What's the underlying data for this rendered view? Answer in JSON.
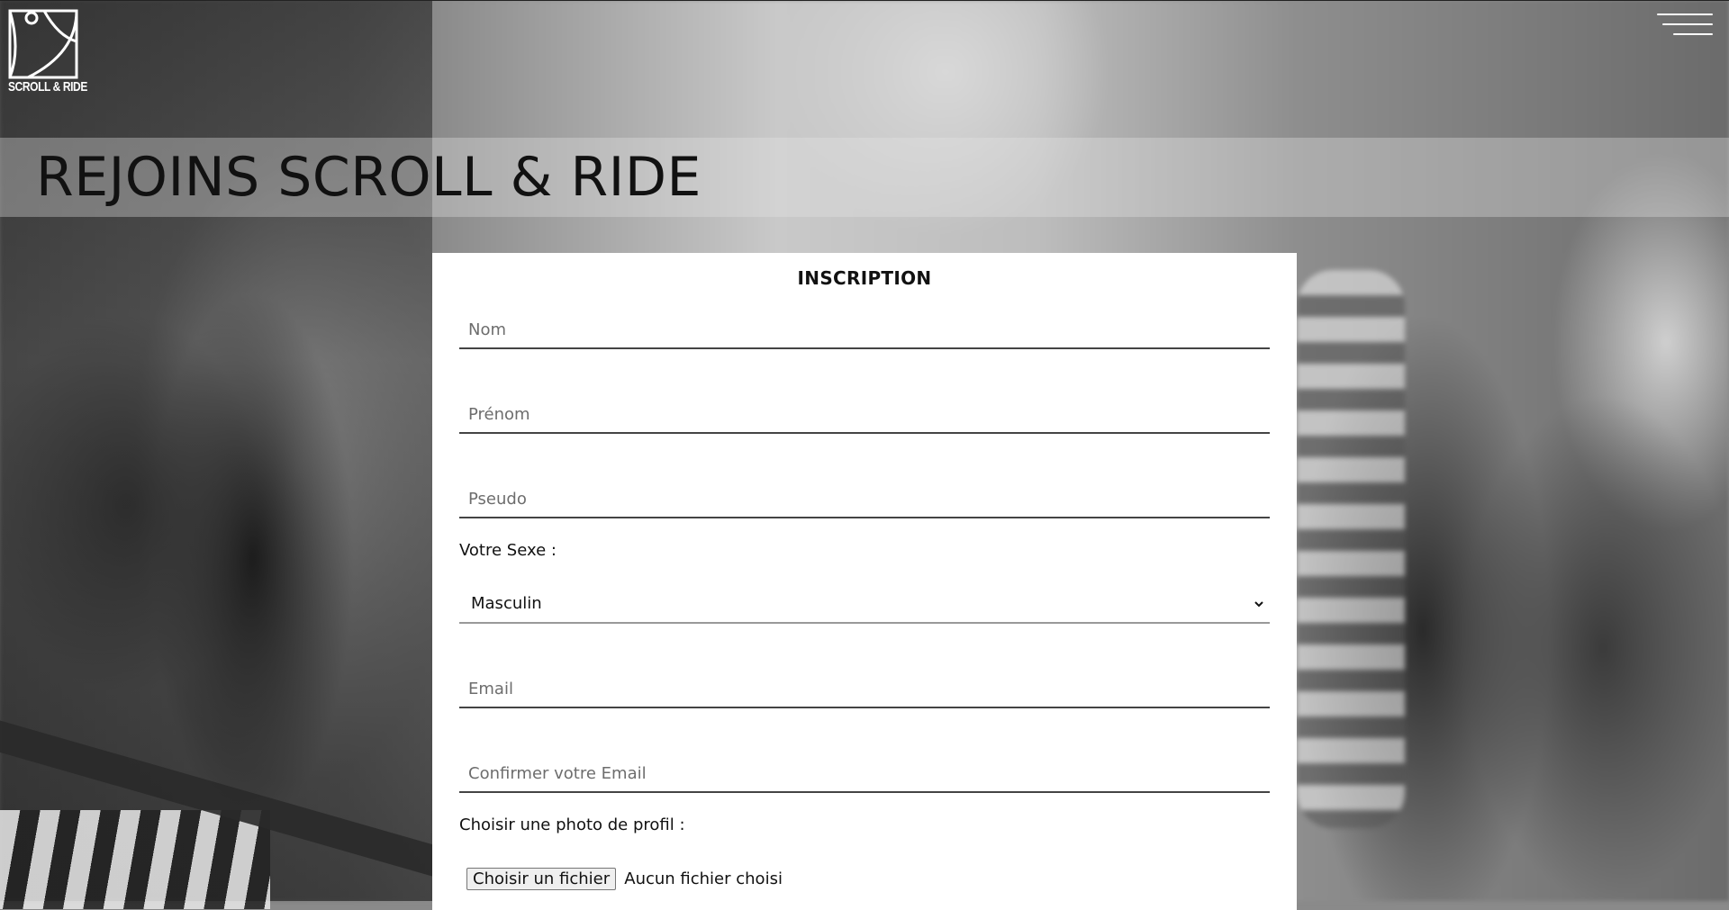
{
  "header": {
    "logo_text": "SCROLL & RIDE",
    "menu_icon": "hamburger-menu-icon"
  },
  "page": {
    "title": "REJOINS SCROLL & RIDE"
  },
  "form": {
    "title": "INSCRIPTION",
    "nom_placeholder": "Nom",
    "prenom_placeholder": "Prénom",
    "pseudo_placeholder": "Pseudo",
    "sexe_label": "Votre Sexe :",
    "sexe_selected": "Masculin",
    "email_placeholder": "Email",
    "confirm_email_placeholder": "Confirmer votre Email",
    "photo_label": "Choisir une photo de profil :",
    "file_button_label": "Choisir un fichier",
    "file_status": "Aucun fichier choisi"
  },
  "colors": {
    "text": "#111111",
    "panel": "#ffffff",
    "underline": "#444444"
  }
}
